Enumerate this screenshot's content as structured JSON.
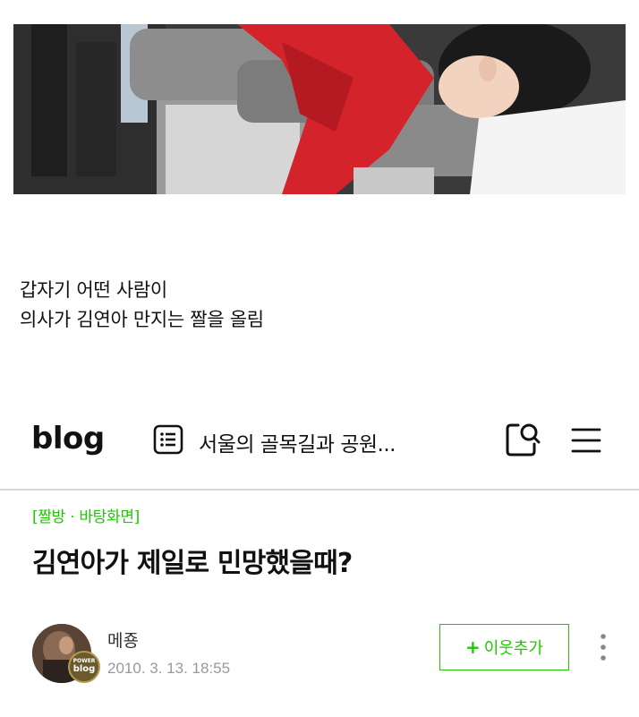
{
  "caption": {
    "line1": "갑자기 어떤 사람이",
    "line2": "의사가 김연아 만지는 짤을 올림"
  },
  "header": {
    "logo": "blog",
    "blog_title": "서울의 골목길과 공원...",
    "icons": [
      "list-icon",
      "search-icon",
      "menu-icon"
    ]
  },
  "post": {
    "category": "[짤방 · 바탕화면]",
    "title": "김연아가 제일로 민망했을때?",
    "author": "메죵",
    "date": "2010. 3. 13. 18:55",
    "badge_top": "POWER",
    "badge_bottom": "blog",
    "add_neighbor_plus": "+",
    "add_neighbor_label": "이웃추가"
  },
  "colors": {
    "accent": "#1ec800",
    "text": "#111111",
    "muted": "#999999"
  }
}
